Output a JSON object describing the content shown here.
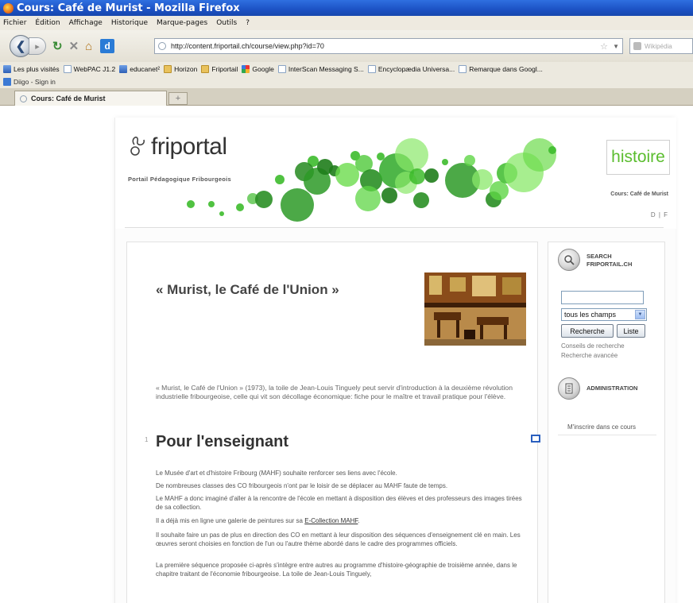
{
  "window": {
    "title": "Cours: Café de Murist - Mozilla Firefox"
  },
  "menu": {
    "items": [
      "Fichier",
      "Édition",
      "Affichage",
      "Historique",
      "Marque-pages",
      "Outils",
      "?"
    ]
  },
  "nav": {
    "url": "http://content.friportail.ch/course/view.php?id=70",
    "search_placeholder": "Wikipédia"
  },
  "bookmarks": {
    "items": [
      {
        "label": "Les plus visités",
        "icon": "bookmark-image-icon"
      },
      {
        "label": "WebPAC J1.2",
        "icon": "bookmark-page-icon"
      },
      {
        "label": "educanet²",
        "icon": "bookmark-image-icon"
      },
      {
        "label": "Horizon",
        "icon": "bookmark-folder-icon"
      },
      {
        "label": "Friportail",
        "icon": "bookmark-folder-icon"
      },
      {
        "label": "Google",
        "icon": "google-icon"
      },
      {
        "label": "InterScan Messaging S...",
        "icon": "bookmark-page-icon"
      },
      {
        "label": "Encyclopædia Universa...",
        "icon": "bookmark-page-icon"
      },
      {
        "label": "Remarque dans Googl...",
        "icon": "bookmark-page-icon"
      }
    ],
    "second_row": "Diigo - Sign in"
  },
  "tabs": {
    "active": "Cours: Café de Murist"
  },
  "site": {
    "logo": "friportal",
    "tagline": "Portail Pédagogique Fribourgeois",
    "subject": "histoire",
    "course_name": "Cours: Café de Murist",
    "languages": "D | F"
  },
  "main": {
    "title": "« Murist, le Café de l'Union »",
    "intro": "« Murist, le Café de l'Union » (1973), la toile de Jean-Louis Tinguely peut servir d'introduction à la deuxième révolution industrielle fribourgeoise, celle qui vit son décollage économique: fiche pour le maître et travail pratique pour l'élève.",
    "section_number": "1",
    "section_title": "Pour l'enseignant",
    "paragraphs": [
      "Le Musée d'art et d'histoire Fribourg (MAHF) souhaite renforcer ses liens avec l'école.",
      "De nombreuses classes des CO fribourgeois n'ont par le loisir de se déplacer au MAHF faute de temps.",
      "Le MAHF a donc imaginé d'aller à la rencontre de l'école en mettant à disposition des élèves et des professeurs des images tirées de sa collection.",
      "Il a déjà mis en ligne une galerie de peintures sur sa ",
      "Il souhaite faire un pas de plus en direction des CO en mettant à leur disposition des séquences d'enseignement clé en main. Les œuvres seront choisies en fonction de l'un ou l'autre thème abordé dans le cadre des programmes officiels.",
      "La première séquence proposée ci-après s'intègre entre autres au programme d'histoire-géographie de troisième année, dans le chapitre traitant de l'économie fribourgeoise. La toile de Jean-Louis Tinguely,"
    ],
    "link": "E-Collection MAHF"
  },
  "sidebar": {
    "search_title_1": "SEARCH",
    "search_title_2": "FRIPORTAIL.CH",
    "select_value": "tous les champs",
    "btn_search": "Recherche",
    "btn_list": "Liste",
    "link_tips": "Conseils de recherche",
    "link_advanced": "Recherche avancée",
    "admin_title": "ADMINISTRATION",
    "enrol": "M'inscrire dans ce cours"
  },
  "colors": {
    "accent_green": "#5bbd2f",
    "titlebar_blue": "#1c52c4"
  }
}
